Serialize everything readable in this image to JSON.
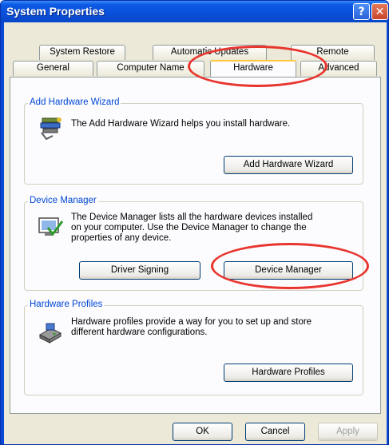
{
  "window": {
    "title": "System Properties",
    "help_glyph": "?",
    "close_glyph": "✕"
  },
  "tabs": {
    "row_back": [
      "System Restore",
      "Automatic Updates",
      "Remote"
    ],
    "row_front": [
      "General",
      "Computer Name",
      "Hardware",
      "Advanced"
    ],
    "active": "Hardware"
  },
  "groups": {
    "add_hardware": {
      "title": "Add Hardware Wizard",
      "description": "The Add Hardware Wizard helps you install hardware.",
      "button": "Add Hardware Wizard",
      "icon": "add-hardware-icon"
    },
    "device_manager": {
      "title": "Device Manager",
      "description_lines": [
        "The Device Manager lists all the hardware devices installed",
        "on your computer. Use the Device Manager to change the",
        "properties of any device."
      ],
      "button_driver": "Driver Signing",
      "button_dm": "Device Manager",
      "icon": "device-manager-icon"
    },
    "hardware_profiles": {
      "title": "Hardware Profiles",
      "description_lines": [
        "Hardware profiles provide a way for you to set up and store",
        "different hardware configurations."
      ],
      "button": "Hardware Profiles",
      "icon": "hardware-profiles-icon"
    }
  },
  "footer": {
    "ok": "OK",
    "cancel": "Cancel",
    "apply": "Apply"
  },
  "colors": {
    "titlebar": "#0a4fd9",
    "dialog": "#ece9d8",
    "group_title": "#0046d5",
    "annotation": "#e8362f"
  }
}
